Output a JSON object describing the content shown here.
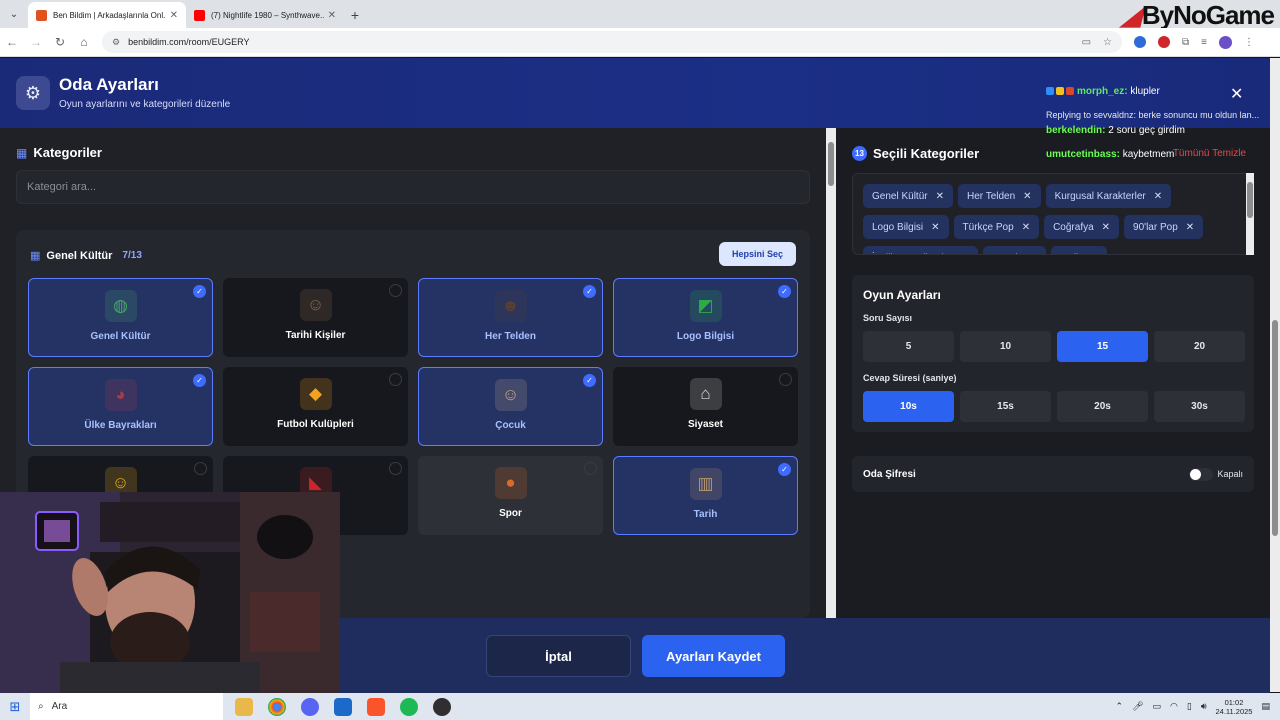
{
  "browser": {
    "tabs": [
      {
        "title": "Ben Bildim | Arkadaşlarınla Onl...",
        "active": true
      },
      {
        "title": "(7) Nightlife 1980 – Synthwave...",
        "active": false
      }
    ],
    "url": "benbildim.com/room/EUGERY",
    "watermark": "ByNoGame"
  },
  "header": {
    "title": "Oda Ayarları",
    "subtitle": "Oyun ayarlarını ve kategorileri düzenle"
  },
  "categories": {
    "title": "Kategoriler",
    "search_placeholder": "Kategori ara...",
    "group": {
      "title": "Genel Kültür",
      "count": "7/13",
      "select_all": "Hepsini Seç",
      "items": [
        {
          "label": "Genel Kültür",
          "selected": true,
          "icon": "globe-icon",
          "color": "#4aa36b"
        },
        {
          "label": "Tarihi Kişiler",
          "selected": false,
          "icon": "portrait-icon",
          "color": "#8a6a4a"
        },
        {
          "label": "Her Telden",
          "selected": true,
          "icon": "sunglasses-icon",
          "color": "#5a4030"
        },
        {
          "label": "Logo Bilgisi",
          "selected": true,
          "icon": "logo-icon",
          "color": "#2faa4a"
        },
        {
          "label": "Ülke Bayrakları",
          "selected": true,
          "icon": "flag-globe-icon",
          "color": "#a83a4a"
        },
        {
          "label": "Futbol Kulüpleri",
          "selected": false,
          "icon": "wolf-badge-icon",
          "color": "#f4a21c"
        },
        {
          "label": "Çocuk",
          "selected": true,
          "icon": "kid-icon",
          "color": "#c8a888"
        },
        {
          "label": "Siyaset",
          "selected": false,
          "icon": "parliament-icon",
          "color": "#d8d8d8"
        },
        {
          "label": "",
          "selected": false,
          "icon": "player-icon",
          "color": "#e8b020"
        },
        {
          "label": "",
          "selected": false,
          "icon": "red-logo-icon",
          "color": "#c8262b"
        },
        {
          "label": "Spor",
          "selected": false,
          "icon": "balls-icon",
          "color": "#d86a2a"
        },
        {
          "label": "Tarih",
          "selected": true,
          "icon": "colosseum-icon",
          "color": "#b89870"
        }
      ]
    }
  },
  "selected_categories": {
    "title": "Seçili Kategoriler",
    "count": "13",
    "clear_all": "Tümünü Temizle",
    "chips": [
      "Genel Kültür",
      "Her Telden",
      "Kurgusal Karakterler",
      "Logo Bilgisi",
      "Türkçe Pop",
      "Coğrafya",
      "90'lar Pop",
      "İngilizce Kelimeler",
      "Çocuk",
      "Tarih"
    ]
  },
  "game_settings": {
    "title": "Oyun Ayarları",
    "question_count_label": "Soru Sayısı",
    "question_options": [
      "5",
      "10",
      "15",
      "20"
    ],
    "question_selected": "15",
    "answer_time_label": "Cevap Süresi (saniye)",
    "time_options": [
      "10s",
      "15s",
      "20s",
      "30s"
    ],
    "time_selected": "10s"
  },
  "room_password": {
    "label": "Oda Şifresi",
    "state": "Kapalı"
  },
  "footer": {
    "cancel": "İptal",
    "save": "Ayarları Kaydet"
  },
  "chat": {
    "messages": [
      {
        "user": "morph_ez:",
        "text": "klupler"
      },
      {
        "user": "",
        "text": "Replying to sevvaldnz: berke sonuncu mu oldun lan..."
      },
      {
        "user": "berkelendin:",
        "text": "2 soru geç girdim"
      },
      {
        "user": "umutcetinbass:",
        "text": "kaybetmem"
      }
    ]
  },
  "taskbar": {
    "search": "Ara",
    "time": "01:02",
    "date": "24.11.2025"
  }
}
